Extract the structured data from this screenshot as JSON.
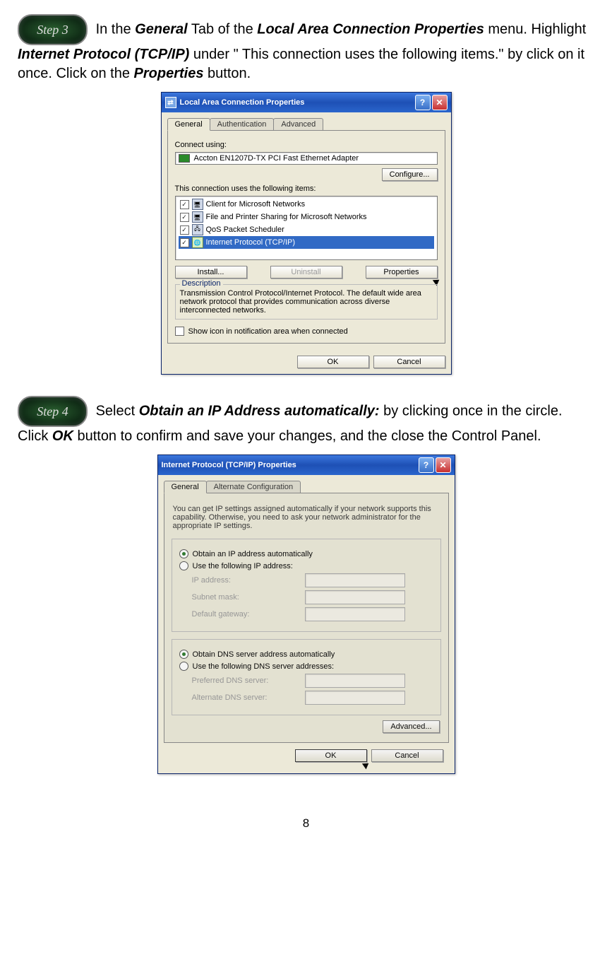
{
  "step3": {
    "badge": "Step 3",
    "t1": "In the ",
    "b1": "General",
    "t2": " Tab of the ",
    "b2": "Local Area Connection Properties",
    "t3": " menu. Highlight ",
    "b3": "Internet Protocol (TCP/IP)",
    "t4": " under \" This connection uses the following items.\"  by click on it once. Click on the ",
    "b4": "Properties",
    "t5": " button."
  },
  "win1": {
    "title": "Local Area Connection Properties",
    "tabs": {
      "general": "General",
      "auth": "Authentication",
      "adv": "Advanced"
    },
    "connect_using": "Connect using:",
    "adapter": "Accton EN1207D-TX PCI Fast Ethernet Adapter",
    "configure": "Configure...",
    "uses_items": "This connection uses the following items:",
    "items": [
      "Client for Microsoft Networks",
      "File and Printer Sharing for Microsoft Networks",
      "QoS Packet Scheduler",
      "Internet Protocol (TCP/IP)"
    ],
    "install": "Install...",
    "uninstall": "Uninstall",
    "properties": "Properties",
    "desc_label": "Description",
    "desc_text": "Transmission Control Protocol/Internet Protocol. The default wide area network protocol that provides communication across diverse interconnected networks.",
    "show_icon": "Show icon in notification area when connected",
    "ok": "OK",
    "cancel": "Cancel"
  },
  "step4": {
    "badge": "Step 4",
    "t1": "Select ",
    "b1": "Obtain an IP Address automatically:",
    "t2": " by clicking once in the circle. Click ",
    "b2": "OK",
    "t3": " button to confirm and save your changes, and the close the Control Panel."
  },
  "win2": {
    "title": "Internet Protocol (TCP/IP) Properties",
    "tabs": {
      "general": "General",
      "alt": "Alternate Configuration"
    },
    "info": "You can get IP settings assigned automatically if your network supports this capability. Otherwise, you need to ask your network administrator for the appropriate IP settings.",
    "r_auto_ip": "Obtain an IP address automatically",
    "r_use_ip": "Use the following IP address:",
    "ip_address": "IP address:",
    "subnet": "Subnet mask:",
    "gateway": "Default gateway:",
    "r_auto_dns": "Obtain DNS server address automatically",
    "r_use_dns": "Use the following DNS server addresses:",
    "pref_dns": "Preferred DNS server:",
    "alt_dns": "Alternate DNS server:",
    "advanced": "Advanced...",
    "ok": "OK",
    "cancel": "Cancel"
  },
  "page_number": "8"
}
